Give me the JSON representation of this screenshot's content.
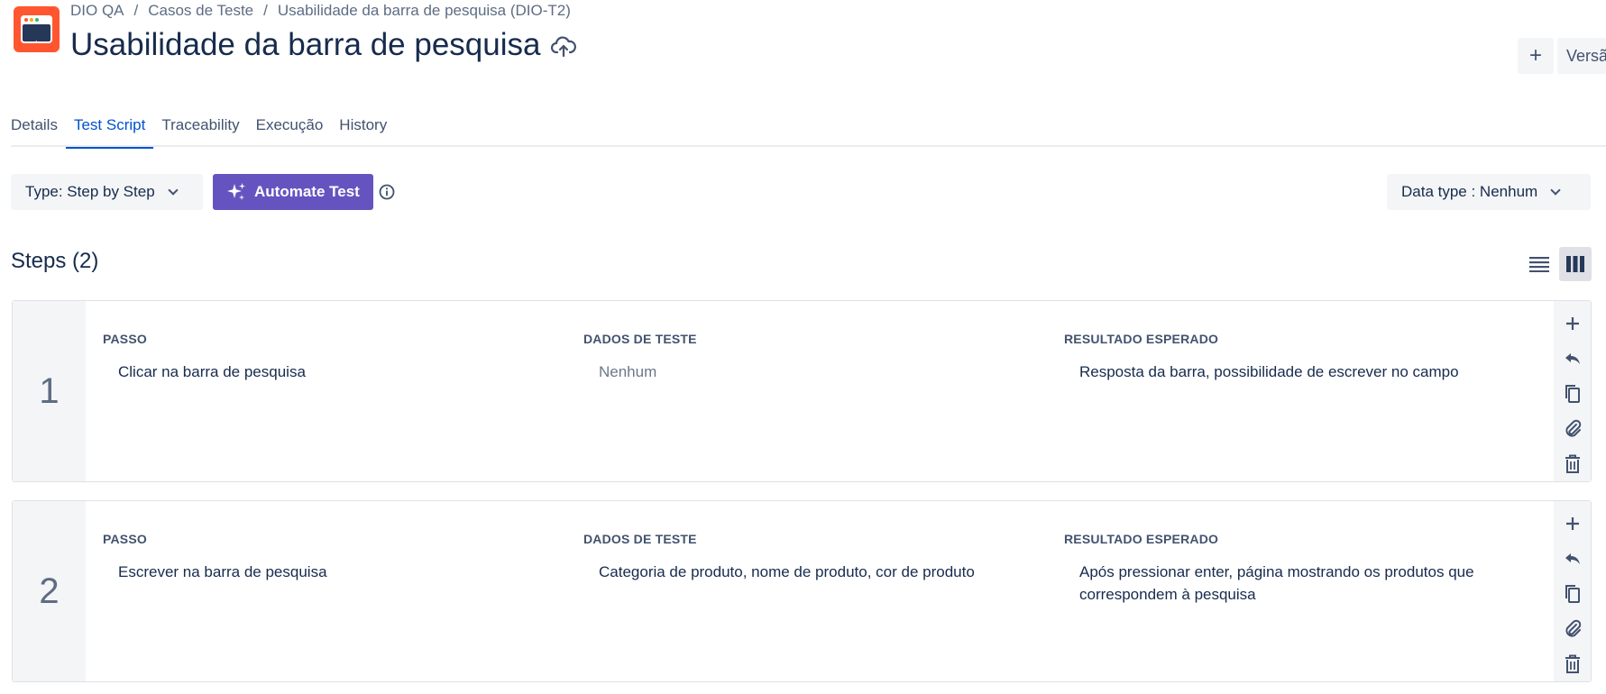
{
  "header": {
    "breadcrumb": [
      "DIO QA",
      "Casos de Teste",
      "Usabilidade da barra de pesquisa (DIO-T2)"
    ],
    "breadcrumb_sep": "/",
    "title": "Usabilidade da barra de pesquisa",
    "add_label": "+",
    "version_label": "Versã"
  },
  "tabs": [
    {
      "label": "Details",
      "active": false
    },
    {
      "label": "Test Script",
      "active": true
    },
    {
      "label": "Traceability",
      "active": false
    },
    {
      "label": "Execução",
      "active": false
    },
    {
      "label": "History",
      "active": false
    }
  ],
  "toolbar": {
    "type_label": "Type: Step by Step",
    "automate_label": "Automate Test",
    "datatype_label": "Data type : Nenhum"
  },
  "steps": {
    "title": "Steps (2)",
    "col_headers": [
      "PASSO",
      "DADOS DE TESTE",
      "RESULTADO ESPERADO"
    ],
    "items": [
      {
        "number": "1",
        "passo": "Clicar na barra de pesquisa",
        "dados": "Nenhum",
        "resultado": "Resposta da barra, possibilidade de escrever no campo"
      },
      {
        "number": "2",
        "passo": "Escrever na barra de pesquisa",
        "dados": "Categoria de produto, nome de produto, cor de produto",
        "resultado": "Após pressionar enter, página mostrando os produtos que correspondem à pesquisa"
      }
    ]
  },
  "colors": {
    "logo": "#ff5630",
    "accent": "#0052cc",
    "automate": "#6554c0",
    "text": "#172b4d"
  },
  "icons": [
    "app-logo",
    "cloud-upload-icon",
    "chevron-down-icon",
    "sparkle-icon",
    "info-icon",
    "list-view-icon",
    "column-view-icon",
    "add-icon",
    "reply-icon",
    "copy-icon",
    "attachment-icon",
    "trash-icon"
  ]
}
